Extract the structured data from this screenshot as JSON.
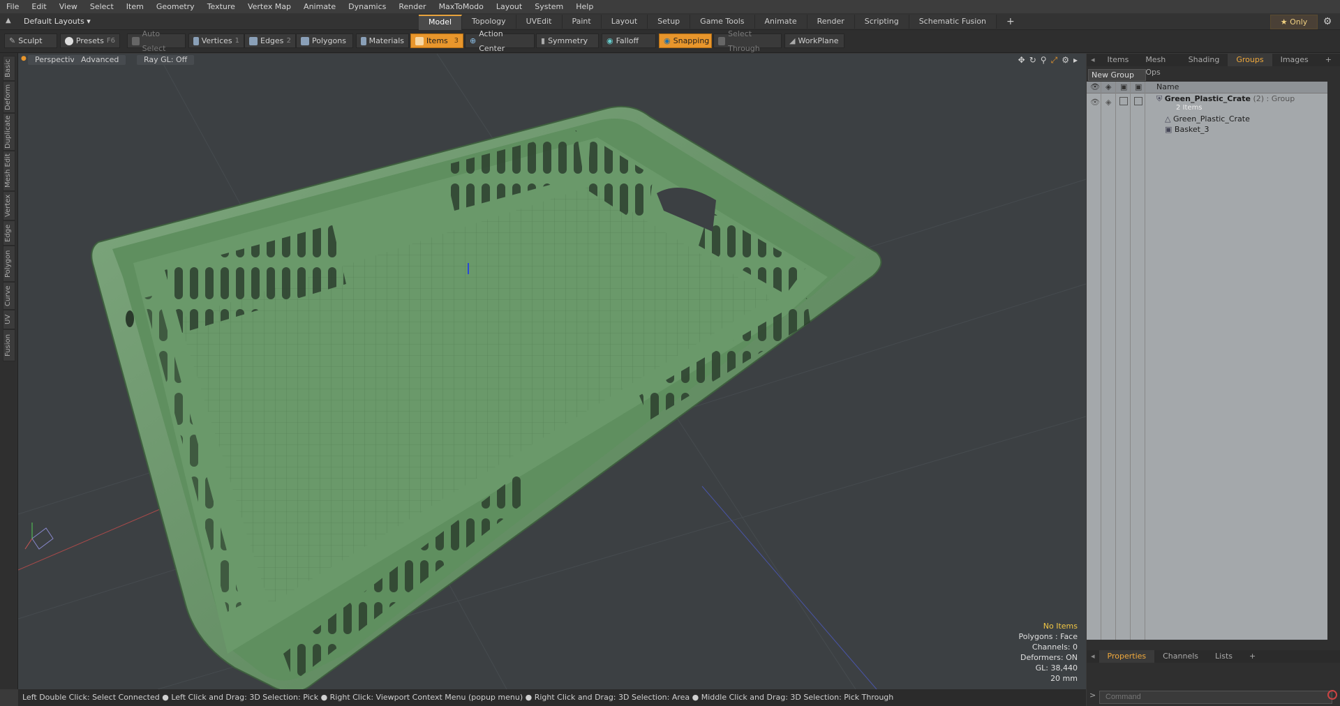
{
  "menu": [
    "File",
    "Edit",
    "View",
    "Select",
    "Item",
    "Geometry",
    "Texture",
    "Vertex Map",
    "Animate",
    "Dynamics",
    "Render",
    "MaxToModo",
    "Layout",
    "System",
    "Help"
  ],
  "layout_dropdown": "Default Layouts ▾",
  "tabs": [
    "Model",
    "Topology",
    "UVEdit",
    "Paint",
    "Layout",
    "Setup",
    "Game Tools",
    "Animate",
    "Render",
    "Scripting",
    "Schematic Fusion"
  ],
  "add_tab": "+",
  "only_label": "★ Only",
  "toolbar": {
    "sculpt": "Sculpt",
    "presets": "Presets",
    "presets_key": "F6",
    "auto_select": "Auto Select",
    "vertices": "Vertices",
    "vertices_count": "1",
    "edges": "Edges",
    "edges_count": "2",
    "polygons": "Polygons",
    "materials": "Materials",
    "items": "Items",
    "items_count": "3",
    "action_center": "Action Center",
    "symmetry": "Symmetry",
    "falloff": "Falloff",
    "snapping": "Snapping",
    "select_through": "Select Through",
    "workplane": "WorkPlane"
  },
  "left_tabs": [
    "Basic",
    "Deform",
    "Duplicate",
    "Mesh Edit",
    "Vertex",
    "Edge",
    "Polygon",
    "Curve",
    "UV",
    "Fusion"
  ],
  "viewport": {
    "perspective": "Perspective",
    "advanced": "Advanced",
    "raygl": "Ray GL: Off",
    "stats": {
      "no_items": "No Items",
      "polygons": "Polygons : Face",
      "channels": "Channels: 0",
      "deformers": "Deformers: ON",
      "gl": "GL: 38,440",
      "scale": "20 mm"
    }
  },
  "status": "Left Double Click: Select Connected ● Left Click and Drag: 3D Selection: Pick ● Right Click: Viewport Context Menu (popup menu) ● Right Click and Drag: 3D Selection: Area ● Middle Click and Drag: 3D Selection: Pick Through",
  "right_panel": {
    "tabs": [
      "Items",
      "Mesh Ops",
      "Shading",
      "Groups",
      "Images"
    ],
    "active_tab": "Groups",
    "new_group": "New Group",
    "name_header": "Name",
    "group_name": "Green_Plastic_Crate",
    "group_count": "(2)",
    "group_type": ": Group",
    "group_sub": "2 Items",
    "children": [
      "Green_Plastic_Crate",
      "Basket_3"
    ],
    "bottom_tabs": [
      "Properties",
      "Channels",
      "Lists"
    ],
    "command_placeholder": "Command"
  },
  "colors": {
    "accent": "#e8962c",
    "crate_green": "#5e8f5e"
  }
}
